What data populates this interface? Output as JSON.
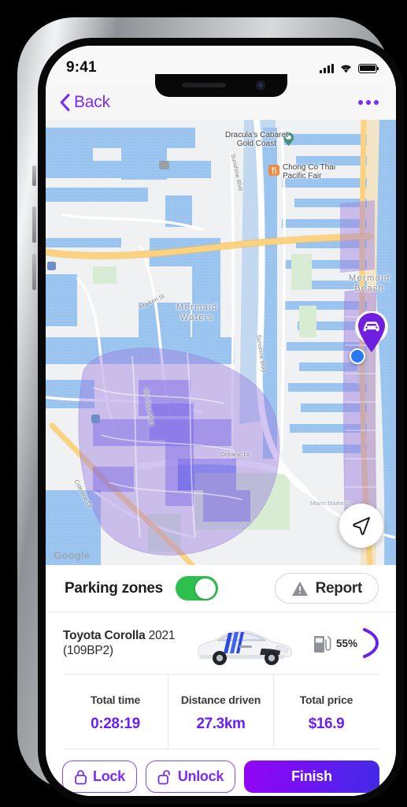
{
  "status_bar": {
    "time": "9:41",
    "cellular_icon": "signal-bars-icon",
    "wifi_icon": "wifi-icon",
    "battery_icon": "battery-full-icon"
  },
  "nav_bar": {
    "back_label": "Back",
    "back_icon": "chevron-left-icon",
    "more_icon": "more-horizontal-icon"
  },
  "map": {
    "attribution": "Google",
    "pois": [
      {
        "name": "Dracula's Cabaret Gold Coast",
        "line1": "Dracula's Cabaret",
        "line2": "Gold Coast",
        "icon": "theater-pin-icon"
      },
      {
        "name": "Chong Co Thai Pacific Fair",
        "line1": "Chong Co Thai",
        "line2": "Pacific Fair",
        "icon": "restaurant-icon"
      }
    ],
    "areas": [
      {
        "line1": "Mermaid",
        "line2": "Waters"
      },
      {
        "line1": "Mermaid",
        "line2": "Beach"
      }
    ],
    "streets": [
      "Sunshine Blvd",
      "Markeri St",
      "Rio Vista Blvd",
      "Oceanic Dr",
      "Cotesloe Dr",
      "Sunshine Blvd"
    ],
    "markers": {
      "car_marker": "car-pin-icon",
      "user_location": "user-location-dot"
    },
    "locate_button_icon": "navigation-arrow-icon",
    "zone_color": "#b79ce8",
    "highway_color": "#fbd27f",
    "water_color": "#8ab9ea"
  },
  "panel": {
    "parking_zones": {
      "label": "Parking zones",
      "toggle_state": "on",
      "toggle_color": "#2fbf4e"
    },
    "report": {
      "label": "Report",
      "icon": "warning-triangle-icon"
    },
    "vehicle": {
      "make_model": "Toyota Corolla",
      "year": "2021",
      "plate": "(109BP2)",
      "image": "white-toyota-corolla-hatchback",
      "fuel_icon": "fuel-pump-icon",
      "fuel_level": "55%",
      "fuel_arc_color": "#6a1ff5"
    },
    "stats": [
      {
        "key": "Total time",
        "value": "0:28:19"
      },
      {
        "key": "Distance driven",
        "value": "27.3km"
      },
      {
        "key": "Total price",
        "value": "$16.9"
      }
    ],
    "actions": {
      "lock": {
        "label": "Lock",
        "icon": "lock-closed-icon"
      },
      "unlock": {
        "label": "Unlock",
        "icon": "lock-open-icon"
      },
      "finish": {
        "label": "Finish"
      }
    }
  },
  "theme": {
    "accent_purple": "#7B2BF9",
    "value_purple": "#6a1ff5",
    "green": "#2fbf4e"
  }
}
